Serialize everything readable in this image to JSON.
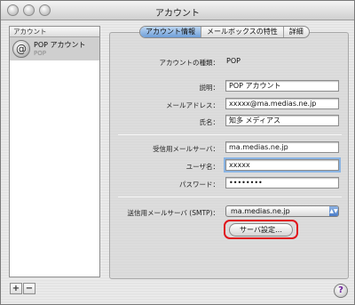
{
  "window": {
    "title": "アカウント"
  },
  "sidebar": {
    "header": "アカウント",
    "accounts": [
      {
        "name": "POP アカウント",
        "type": "POP"
      }
    ],
    "add_label": "+",
    "remove_label": "−"
  },
  "tabs": [
    "アカウント情報",
    "メールボックスの特性",
    "詳細"
  ],
  "form": {
    "account_type_label": "アカウントの種類：",
    "account_type_value": "POP",
    "description_label": "説明：",
    "description_value": "POP アカウント",
    "email_label": "メールアドレス：",
    "email_value": "xxxxx@ma.medias.ne.jp",
    "fullname_label": "氏名：",
    "fullname_value": "知多 メディアス",
    "incoming_server_label": "受信用メールサーバ：",
    "incoming_server_value": "ma.medias.ne.jp",
    "username_label": "ユーザ名：",
    "username_value": "xxxxx",
    "password_label": "パスワード：",
    "password_value": "••••••••",
    "smtp_label": "送信用メールサーバ (SMTP)：",
    "smtp_value": "ma.medias.ne.jp",
    "server_settings_button": "サーバ設定…"
  },
  "help_label": "?"
}
